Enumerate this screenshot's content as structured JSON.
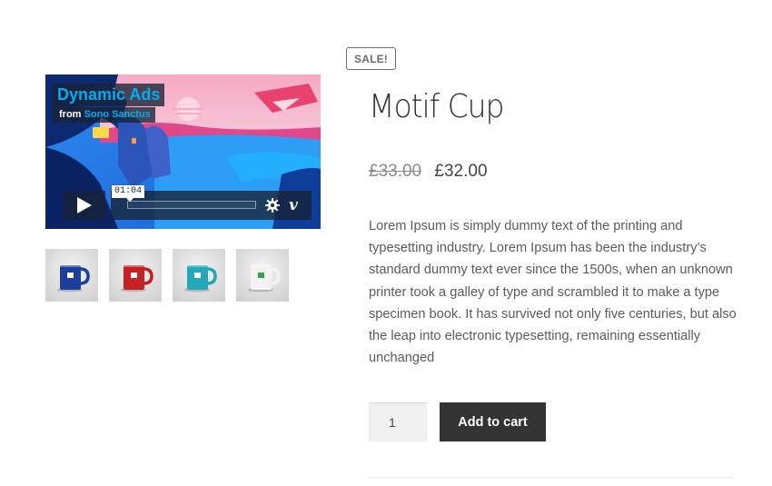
{
  "product": {
    "sale_badge": "SALE!",
    "title": "Motif Cup",
    "price_old": "£33.00",
    "price_new": "£32.00",
    "description": "Lorem Ipsum is simply dummy text of the printing and typesetting industry. Lorem Ipsum has been the industry’s standard dummy text ever since the 1500s, when an unknown printer took a galley of type and scrambled it to make a type specimen book. It has survived not only five centuries, but also the leap into electronic typesetting, remaining essentially unchanged",
    "quantity": "1",
    "add_to_cart_label": "Add to cart"
  },
  "video": {
    "title": "Dynamic Ads",
    "byline_prefix": "from",
    "author": "Sono Sanctus",
    "time_tooltip": "01:04",
    "brand_mark": "v",
    "progress": 0.0
  },
  "gallery": {
    "thumbnails": [
      {
        "name": "mug-blue",
        "color": "#1c3f9c"
      },
      {
        "name": "mug-red",
        "color": "#c52024"
      },
      {
        "name": "mug-teal",
        "color": "#22a8b8"
      },
      {
        "name": "mug-white",
        "color": "#f2f2f2"
      }
    ]
  },
  "colors": {
    "video_accent": "#00adef",
    "button_bg": "#333333",
    "text": "#43454b"
  }
}
